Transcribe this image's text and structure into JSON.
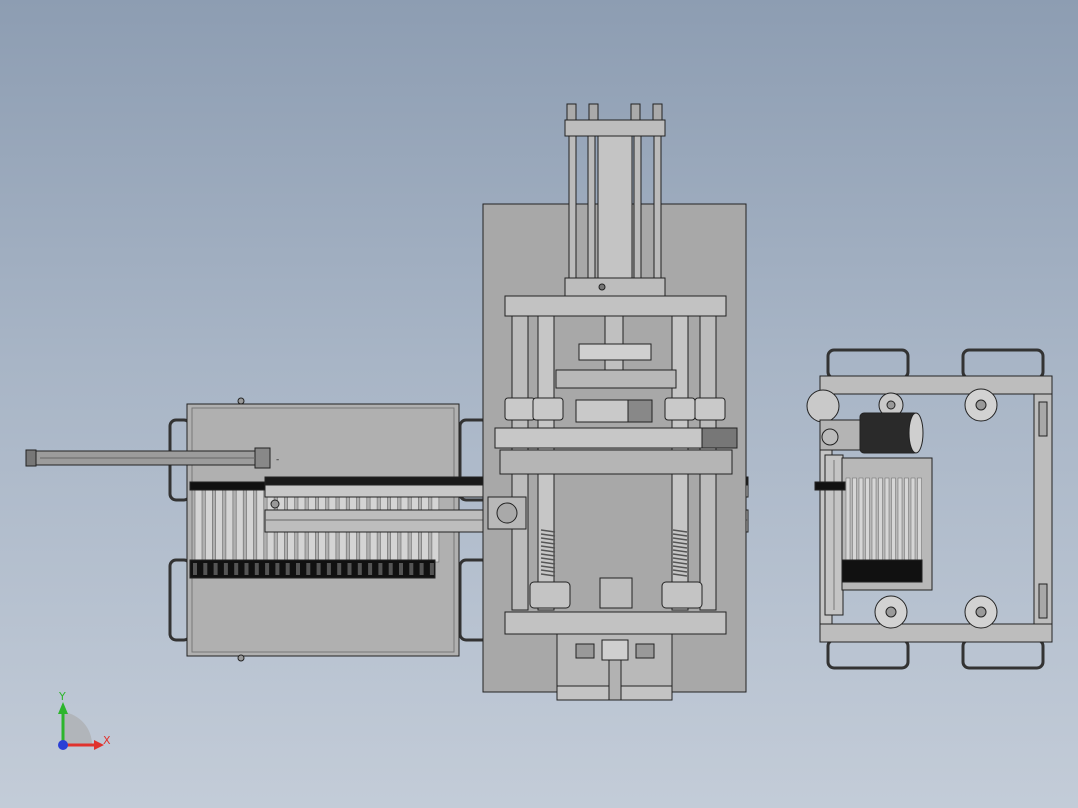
{
  "view": {
    "background_top": "#8d9db2",
    "background_bottom": "#c3ccd8",
    "part_fill": "#b4b4b4",
    "part_dark": "#8a8a8a",
    "part_light": "#d6d6d6",
    "edge_color": "#222222"
  },
  "triad": {
    "x_label": "X",
    "y_label": "Y",
    "x_color": "#e0322d",
    "y_color": "#2cb52c",
    "z_color": "#2a3fd6"
  }
}
